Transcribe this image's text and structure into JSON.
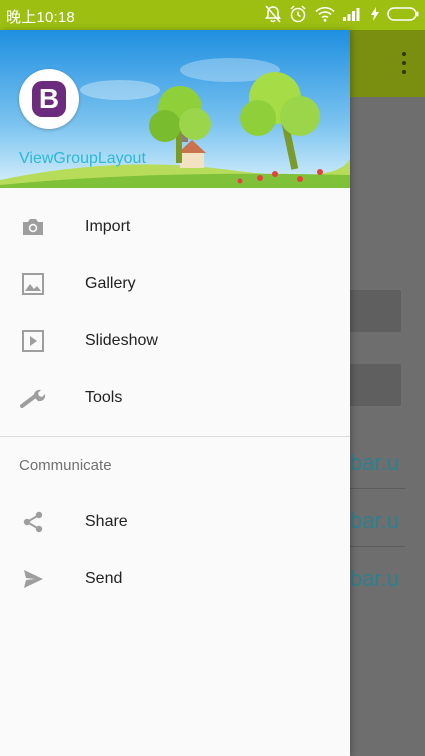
{
  "status": {
    "time": "晚上10:18",
    "icons": [
      "alarm-off-icon",
      "alarm-clock-icon",
      "wifi-icon",
      "signal-icon",
      "charging-icon",
      "battery-icon"
    ]
  },
  "background_app": {
    "links": [
      "bar.u",
      "bar.u",
      "bar.u"
    ],
    "colors": {
      "toolbar": "#7a8f10",
      "link": "#2f7f8c"
    }
  },
  "drawer": {
    "header": {
      "avatar_letter": "B",
      "title": "ViewGroupLayout"
    },
    "items": [
      {
        "label": "Import",
        "icon": "camera-icon"
      },
      {
        "label": "Gallery",
        "icon": "image-icon"
      },
      {
        "label": "Slideshow",
        "icon": "slideshow-icon"
      },
      {
        "label": "Tools",
        "icon": "wrench-icon"
      }
    ],
    "section_title": "Communicate",
    "section_items": [
      {
        "label": "Share",
        "icon": "share-icon"
      },
      {
        "label": "Send",
        "icon": "send-icon"
      }
    ],
    "colors": {
      "title": "#2ab9d6",
      "avatar": "#6b2c7e",
      "status_bar": "#9cbf12"
    }
  }
}
